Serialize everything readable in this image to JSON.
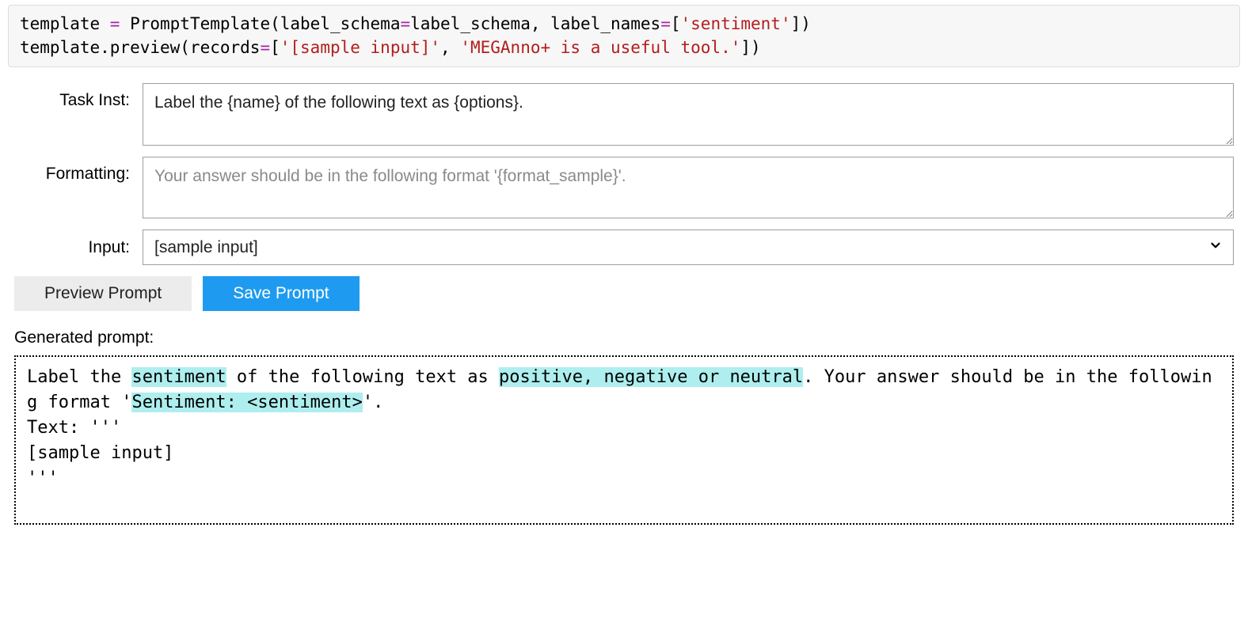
{
  "code": {
    "line1_parts": {
      "a": "template ",
      "op1": "= ",
      "b": "PromptTemplate(label_schema",
      "op2": "=",
      "c": "label_schema, label_names",
      "op3": "=",
      "d": "[",
      "str1": "'sentiment'",
      "e": "])"
    },
    "line2_parts": {
      "a": "template.preview(records",
      "op1": "=",
      "b": "[",
      "str1": "'[sample input]'",
      "c": ", ",
      "str2": "'MEGAnno+ is a useful tool.'",
      "d": "])"
    }
  },
  "form": {
    "task_inst_label": "Task Inst:",
    "task_inst_value": "Label the {name} of the following text as {options}.",
    "formatting_label": "Formatting:",
    "formatting_placeholder": "Your answer should be in the following format '{format_sample}'.",
    "input_label": "Input:",
    "input_selected": "[sample input]"
  },
  "buttons": {
    "preview": "Preview Prompt",
    "save": "Save Prompt"
  },
  "generated": {
    "label": "Generated prompt:",
    "seg1": "Label the ",
    "hl1": "sentiment",
    "seg2": " of the following text as ",
    "hl2": "positive, negative or neutral",
    "seg3": ". Your answer should be in the following format '",
    "hl3": "Sentiment: <sentiment>",
    "seg4": "'.",
    "blank": " ",
    "line3": "Text: '''",
    "line4": "[sample input]",
    "line5": "'''"
  }
}
